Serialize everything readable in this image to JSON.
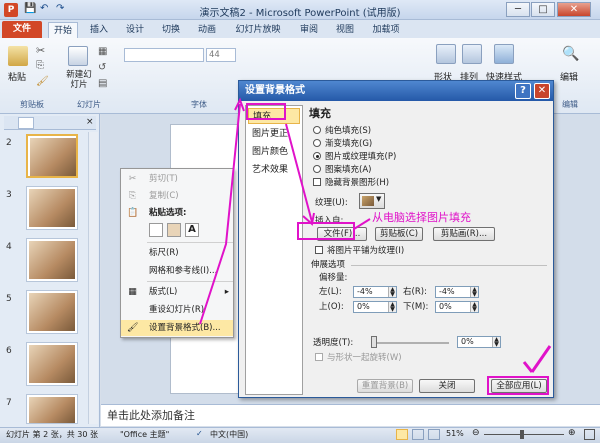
{
  "window": {
    "title": "演示文稿2 - Microsoft PowerPoint (试用版)",
    "min": "─",
    "max": "□",
    "close": "✕"
  },
  "ribbon": {
    "tabs": [
      "文件",
      "开始",
      "插入",
      "设计",
      "切换",
      "动画",
      "幻灯片放映",
      "审阅",
      "视图",
      "加载项"
    ],
    "groups": {
      "clipboard": "剪贴板",
      "slides": "幻灯片",
      "font": "字体",
      "editing": "编辑"
    },
    "buttons": {
      "paste": "粘贴",
      "new_slide": "新建幻灯片",
      "shape": "形状",
      "arrange": "排列",
      "quick_styles": "快速样式",
      "edit": "编辑"
    },
    "font_size": "44"
  },
  "slides": [
    {
      "num": "2"
    },
    {
      "num": "3"
    },
    {
      "num": "4"
    },
    {
      "num": "5"
    },
    {
      "num": "6"
    },
    {
      "num": "7"
    }
  ],
  "context_menu": {
    "items": [
      {
        "label": "剪切(T)",
        "icon": "✂",
        "disabled": true
      },
      {
        "label": "复制(C)",
        "icon": "⎘",
        "disabled": true
      },
      {
        "label": "粘贴选项:",
        "icon": "📋",
        "disabled": false
      },
      {
        "label": "标尺(R)",
        "icon": "",
        "disabled": false
      },
      {
        "label": "网格和参考线(I)...",
        "icon": "",
        "disabled": false
      },
      {
        "label": "版式(L)",
        "icon": "▦",
        "disabled": false,
        "submenu": "▸"
      },
      {
        "label": "重设幻灯片(R)",
        "icon": "",
        "disabled": false
      },
      {
        "label": "设置背景格式(B)...",
        "icon": "🖌",
        "disabled": false
      }
    ],
    "paste_option": "A"
  },
  "dialog": {
    "title": "设置背景格式",
    "help": "?",
    "close": "✕",
    "nav": [
      "填充",
      "图片更正",
      "图片颜色",
      "艺术效果"
    ],
    "heading": "填充",
    "fill_options": [
      "纯色填充(S)",
      "渐变填充(G)",
      "图片或纹理填充(P)",
      "图案填充(A)"
    ],
    "hide_bg": "隐藏背景图形(H)",
    "texture_label": "纹理(U):",
    "insert_from": "插入自:",
    "insert_buttons": {
      "file": "文件(F)...",
      "clipboard": "剪贴板(C)",
      "clipart": "剪贴画(R)..."
    },
    "tile": "将图片平铺为纹理(I)",
    "stretch": "伸展选项",
    "offset": "偏移量:",
    "left": {
      "label": "左(L):",
      "value": "-4%"
    },
    "right": {
      "label": "右(R):",
      "value": "-4%"
    },
    "top": {
      "label": "上(O):",
      "value": "0%"
    },
    "bottom": {
      "label": "下(M):",
      "value": "0%"
    },
    "transparency": {
      "label": "透明度(T):",
      "value": "0%",
      "level": 0
    },
    "rotate": "与形状一起旋转(W)",
    "buttons": {
      "reset": "重置背景(B)",
      "close": "关闭",
      "apply_all": "全部应用(L)"
    }
  },
  "annotation": "从电脑选择图片填充",
  "notes": "单击此处添加备注",
  "status": {
    "slide_info": "幻灯片 第 2 张，共 30 张",
    "theme": "\"Office 主题\"",
    "language": "中文(中国)",
    "zoom": "51%"
  },
  "colors": {
    "accent": "#e012c9",
    "file_tab": "#d24726",
    "title_bar": "#2559a8"
  }
}
